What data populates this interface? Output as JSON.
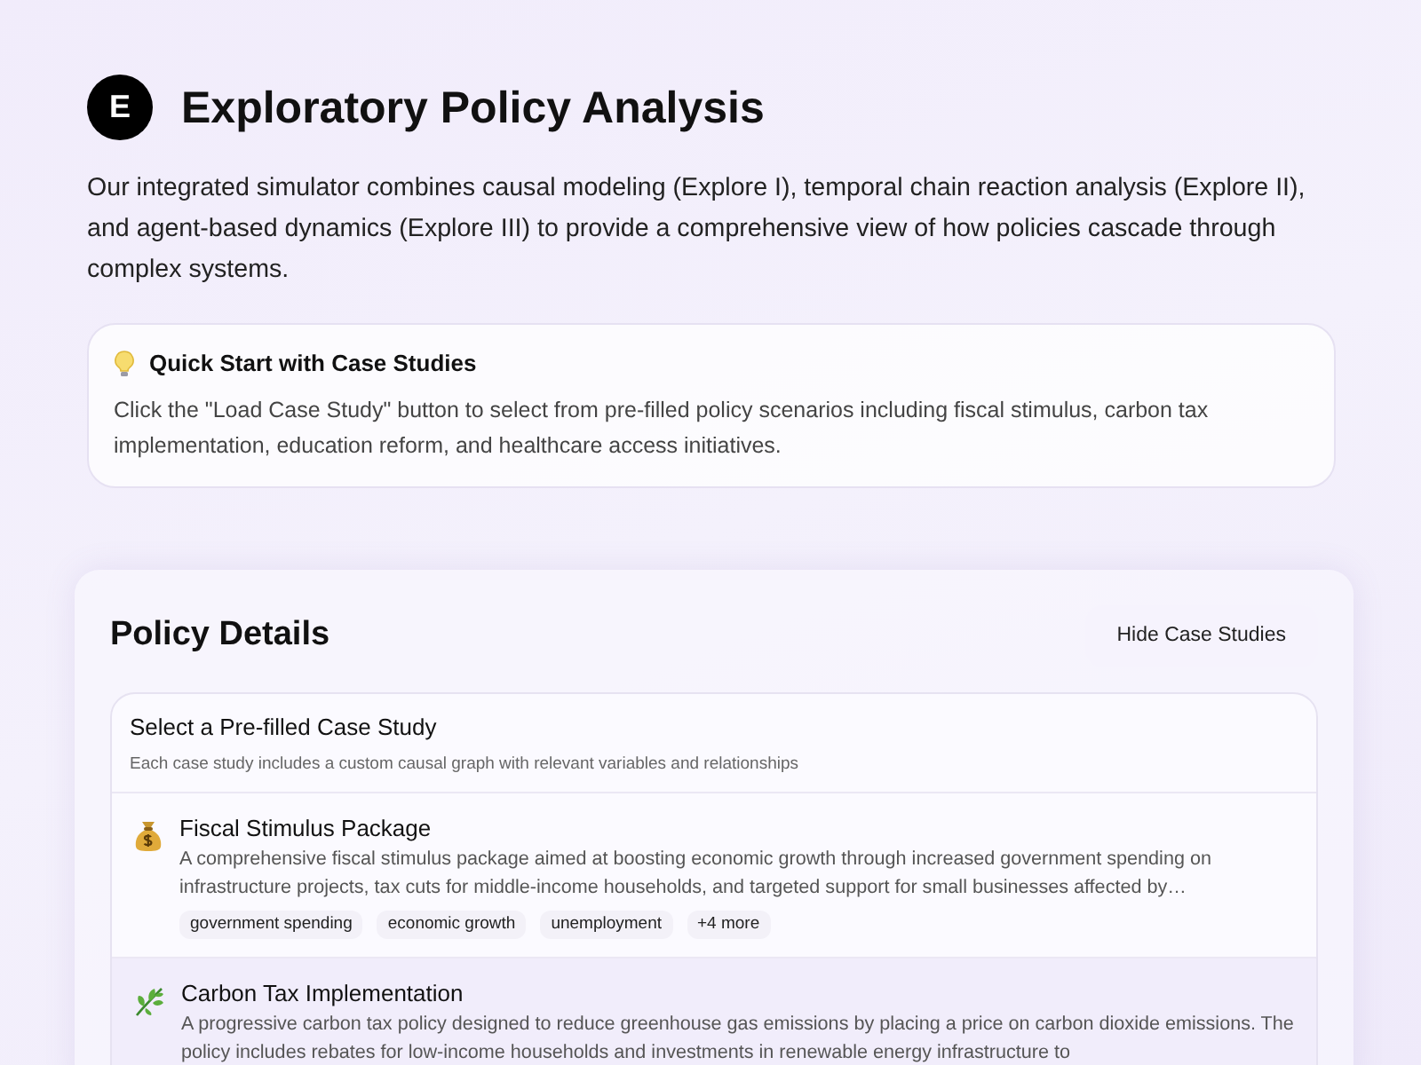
{
  "header": {
    "logo_letter": "E",
    "title": "Exploratory Policy Analysis",
    "intro": "Our integrated simulator combines causal modeling (Explore I), temporal chain reaction analysis (Explore II), and agent-based dynamics (Explore III) to provide a comprehensive view of how policies cascade through complex systems."
  },
  "tip": {
    "title": "Quick Start with Case Studies",
    "text": "Click the \"Load Case Study\" button to select from pre-filled policy scenarios including fiscal stimulus, carbon tax implementation, education reform, and healthcare access initiatives."
  },
  "policy_details": {
    "title": "Policy Details",
    "toggle_button": "Hide Case Studies",
    "case_studies": {
      "title": "Select a Pre-filled Case Study",
      "subtitle": "Each case study includes a custom causal graph with relevant variables and relationships",
      "items": [
        {
          "kind": "money",
          "selected": false,
          "name": "Fiscal Stimulus Package",
          "description": "A comprehensive fiscal stimulus package aimed at boosting economic growth through increased government spending on infrastructure projects, tax cuts for middle-income households, and targeted support for small businesses affected by…",
          "tags": [
            "government spending",
            "economic growth",
            "unemployment",
            "+4 more"
          ]
        },
        {
          "kind": "leaf",
          "selected": true,
          "name": "Carbon Tax Implementation",
          "description": "A progressive carbon tax policy designed to reduce greenhouse gas emissions by placing a price on carbon dioxide emissions. The policy includes rebates for low-income households and investments in renewable energy infrastructure to"
        }
      ]
    }
  }
}
